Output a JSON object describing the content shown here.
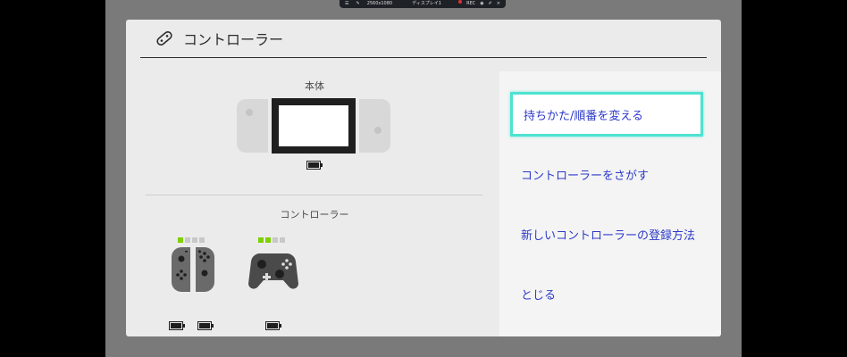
{
  "overlay": {
    "resolution": "2560x1080",
    "display_label": "ディスプレイ1",
    "rec_label": "REC"
  },
  "dialog": {
    "title": "コントローラー",
    "console_label": "本体",
    "controllers_label": "コントローラー",
    "controllers": [
      {
        "type": "joy-con-pair",
        "player_leds": [
          true,
          false,
          false,
          false
        ]
      },
      {
        "type": "pro-controller",
        "player_leds": [
          true,
          true,
          false,
          false
        ]
      }
    ]
  },
  "menu": {
    "items": [
      {
        "label": "持ちかた/順番を変える",
        "selected": true
      },
      {
        "label": "コントローラーをさがす",
        "selected": false
      },
      {
        "label": "新しいコントローラーの登録方法",
        "selected": false
      },
      {
        "label": "とじる",
        "selected": false
      }
    ]
  },
  "colors": {
    "accent_text": "#2c3ac9",
    "focus_border": "#4ee3d0",
    "led_on": "#7fd000"
  }
}
